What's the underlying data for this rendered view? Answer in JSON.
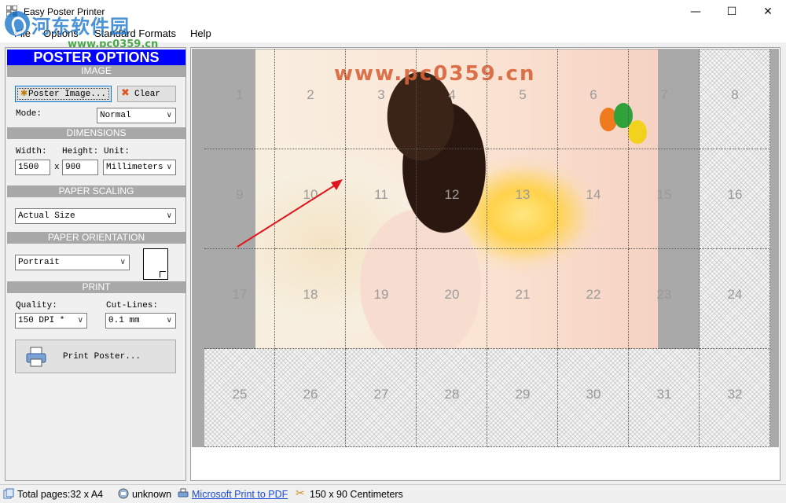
{
  "window": {
    "title": "Easy Poster Printer",
    "controls": {
      "minimize": "—",
      "maximize": "☐",
      "close": "✕"
    }
  },
  "watermark": {
    "cn_text": "河东软件园",
    "url": "www.pc0359.cn"
  },
  "menu": [
    "File",
    "Options",
    "Standard Formats",
    "Help"
  ],
  "panel": {
    "header": "POSTER OPTIONS",
    "image": {
      "section": "IMAGE",
      "poster_image_btn": "Poster Image...",
      "clear_btn": "Clear",
      "mode_label": "Mode:",
      "mode_value": "Normal"
    },
    "dimensions": {
      "section": "DIMENSIONS",
      "width_label": "Width:",
      "height_label": "Height:",
      "unit_label": "Unit:",
      "width_value": "1500",
      "times": "x",
      "height_value": "900",
      "unit_value": "Millimeters"
    },
    "scaling": {
      "section": "PAPER SCALING",
      "value": "Actual Size"
    },
    "orientation": {
      "section": "PAPER ORIENTATION",
      "value": "Portrait"
    },
    "print": {
      "section": "PRINT",
      "quality_label": "Quality:",
      "cutlines_label": "Cut-Lines:",
      "quality_value": "150 DPI *",
      "cutlines_value": "0.1 mm",
      "print_btn": "Print Poster..."
    }
  },
  "canvas": {
    "photo_watermark": "www.pc0359.cn",
    "tiles": [
      {
        "n": "1",
        "covered": true
      },
      {
        "n": "2",
        "covered": true
      },
      {
        "n": "3",
        "covered": true
      },
      {
        "n": "4",
        "covered": true
      },
      {
        "n": "5",
        "covered": true
      },
      {
        "n": "6",
        "covered": true
      },
      {
        "n": "7",
        "covered": true
      },
      {
        "n": "8",
        "covered": false
      },
      {
        "n": "9",
        "covered": true
      },
      {
        "n": "10",
        "covered": true
      },
      {
        "n": "11",
        "covered": true
      },
      {
        "n": "12",
        "covered": true
      },
      {
        "n": "13",
        "covered": true
      },
      {
        "n": "14",
        "covered": true
      },
      {
        "n": "15",
        "covered": true
      },
      {
        "n": "16",
        "covered": false
      },
      {
        "n": "17",
        "covered": true
      },
      {
        "n": "18",
        "covered": true
      },
      {
        "n": "19",
        "covered": true
      },
      {
        "n": "20",
        "covered": true
      },
      {
        "n": "21",
        "covered": true
      },
      {
        "n": "22",
        "covered": true
      },
      {
        "n": "23",
        "covered": true
      },
      {
        "n": "24",
        "covered": false
      },
      {
        "n": "25",
        "covered": false
      },
      {
        "n": "26",
        "covered": false
      },
      {
        "n": "27",
        "covered": false
      },
      {
        "n": "28",
        "covered": false
      },
      {
        "n": "29",
        "covered": false
      },
      {
        "n": "30",
        "covered": false
      },
      {
        "n": "31",
        "covered": false
      },
      {
        "n": "32",
        "covered": false
      }
    ]
  },
  "status": {
    "total_pages": "Total pages:32 x A4",
    "unknown": "unknown",
    "printer": "Microsoft Print to PDF",
    "size": "150 x 90 Centimeters"
  },
  "colors": {
    "header_blue": "#0000ff",
    "section_gray": "#a8a8a8",
    "link": "#1a4ad6",
    "arrow": "#e0141e"
  }
}
